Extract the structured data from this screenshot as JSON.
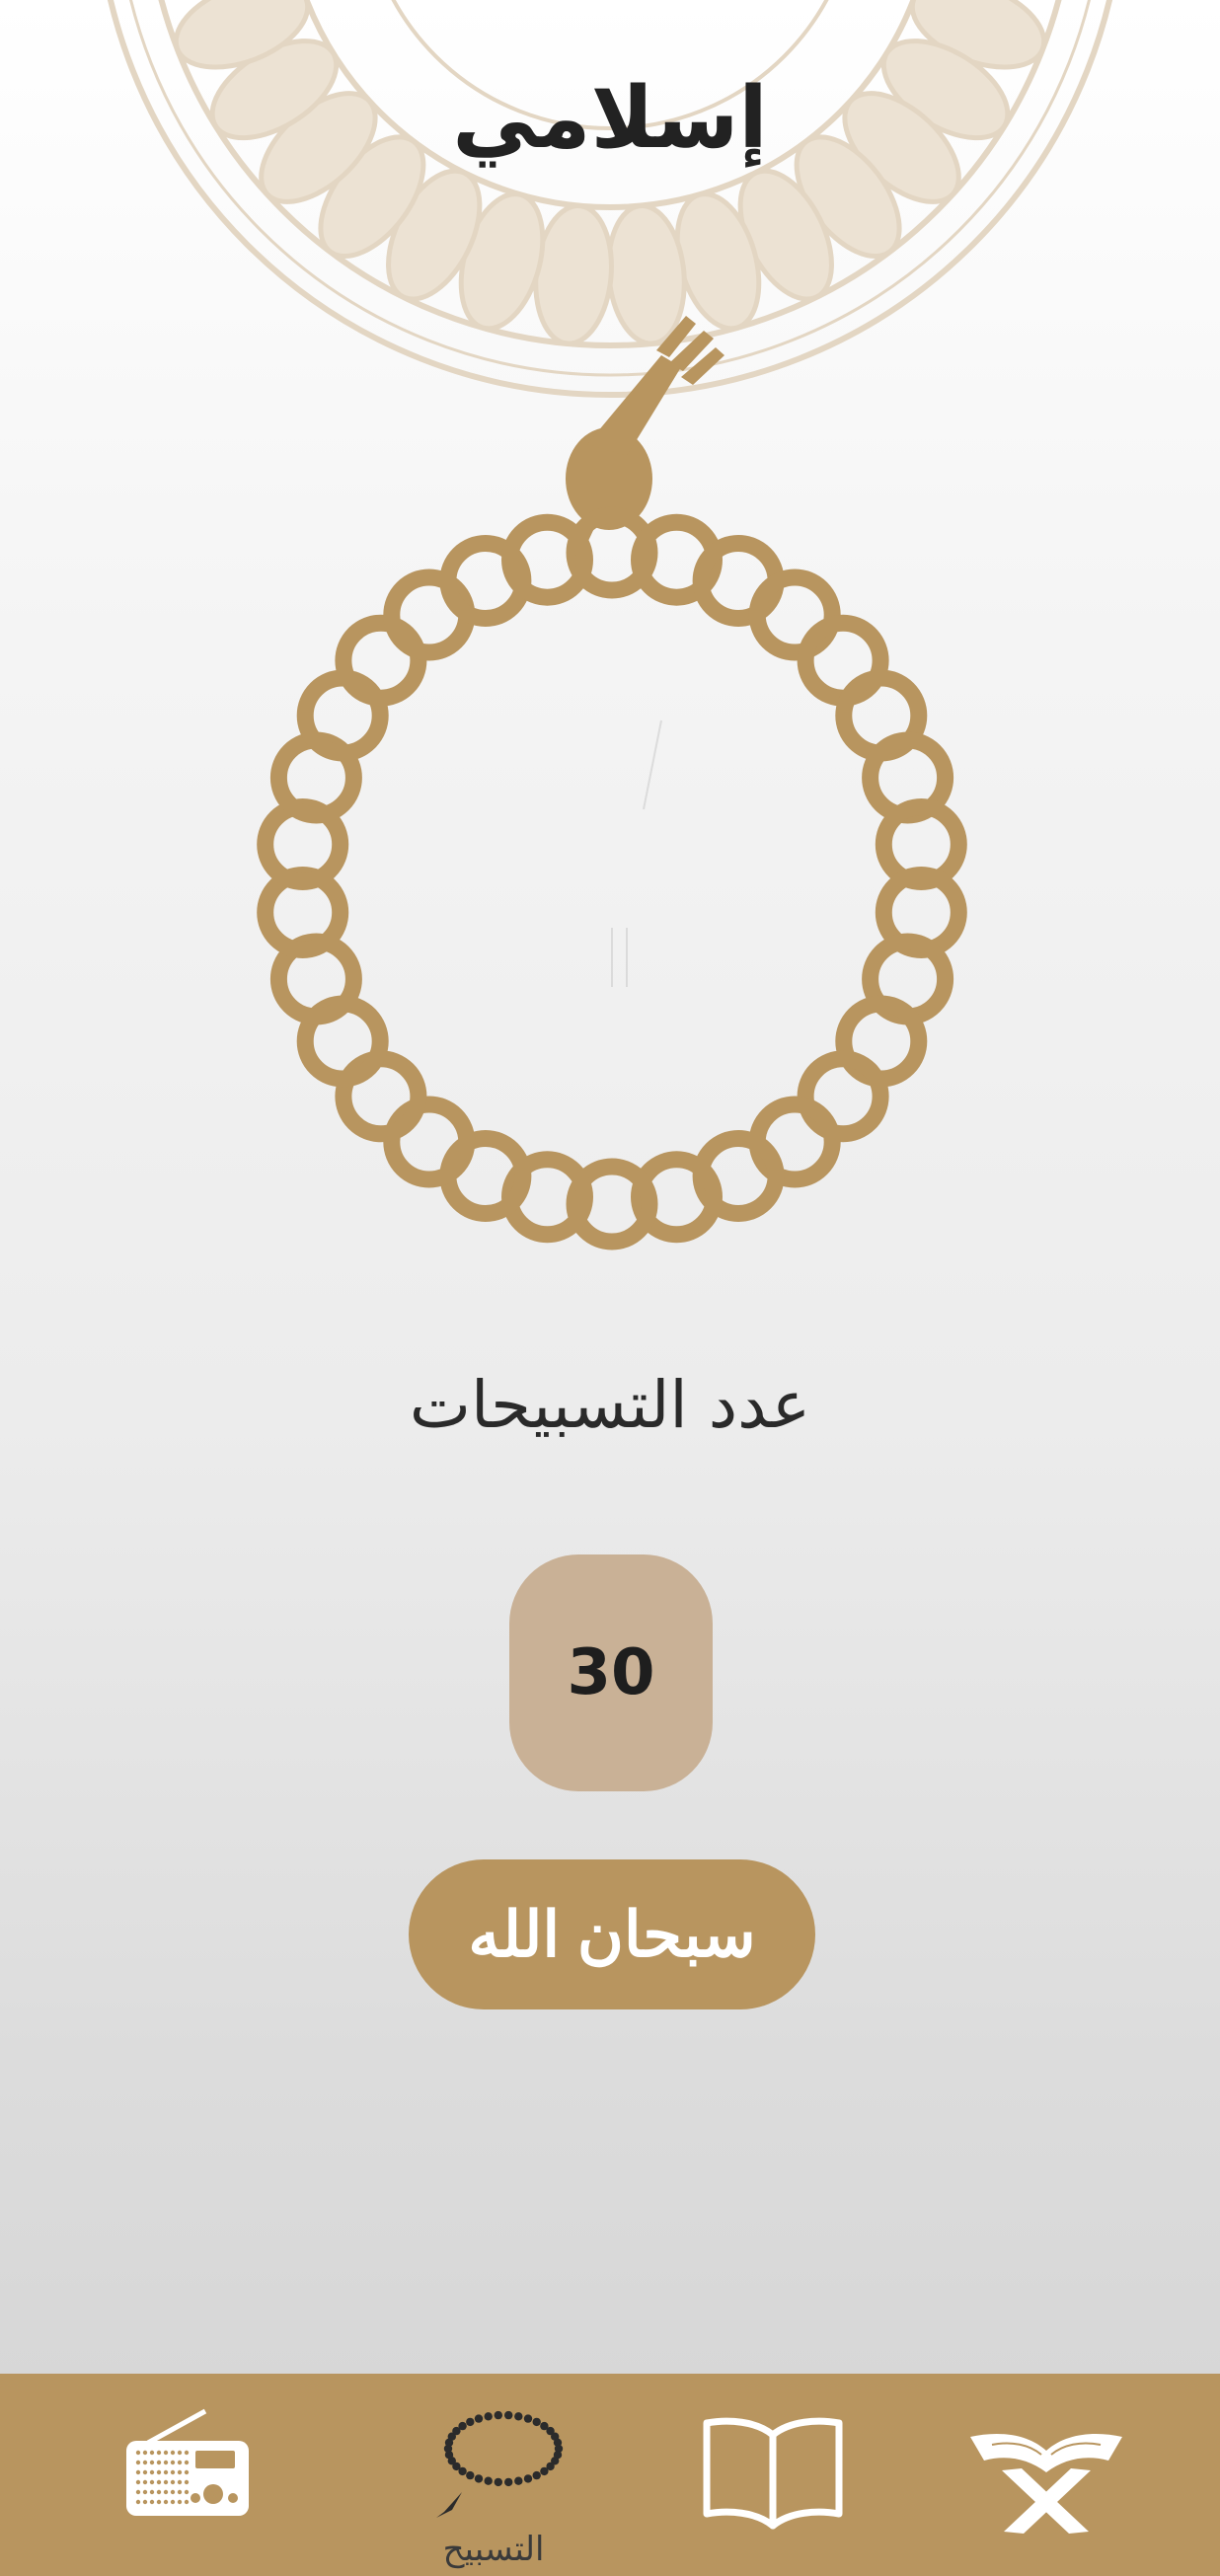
{
  "app": {
    "title": "إسلامي"
  },
  "tasbih": {
    "count_label": "عدد التسبيحات",
    "count": "30",
    "dhikr_button": "سبحان الله"
  },
  "bottom_nav": {
    "items": [
      {
        "icon": "radio-icon",
        "label": "",
        "active": false
      },
      {
        "icon": "prayer-beads-icon",
        "label": "التسبيح",
        "active": true
      },
      {
        "icon": "open-book-icon",
        "label": "",
        "active": false
      },
      {
        "icon": "quran-stand-icon",
        "label": "",
        "active": false
      }
    ]
  },
  "colors": {
    "accent": "#b8955f",
    "counter_bg": "#c9b196",
    "mandala": "#e3d6c3",
    "text": "#222222"
  }
}
